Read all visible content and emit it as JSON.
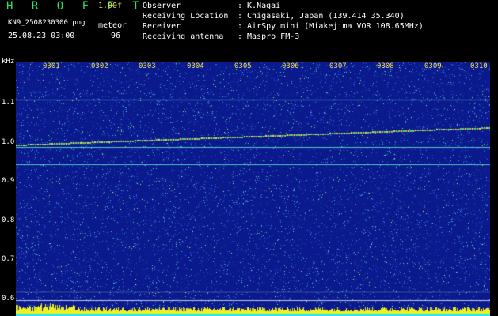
{
  "header": {
    "app_title": "H R O F F T",
    "version": "1.00f",
    "filename": "KN9_2508230300.png",
    "meteor_label": "meteor",
    "datetime": "25.08.23 03:00",
    "meteor_count": "96",
    "info": [
      {
        "label": "Observer",
        "value": ": K.Nagai"
      },
      {
        "label": "Receiving Location",
        "value": ": Chigasaki, Japan (139.414 35.340)"
      },
      {
        "label": "Receiver",
        "value": ": AirSpy mini (Miakejima VOR 108.65MHz)"
      },
      {
        "label": "Receiving antenna",
        "value": ": Maspro FM-3"
      }
    ]
  },
  "spectrogram": {
    "y_unit": "kHz",
    "y_ticks": [
      "1.1",
      "1.0",
      "0.9",
      "0.8",
      "0.7",
      "0.6"
    ],
    "x_ticks": [
      "0301",
      "0302",
      "0303",
      "0304",
      "0305",
      "0306",
      "0307",
      "0308",
      "0309",
      "0310"
    ]
  },
  "colors": {
    "background": "#0a1a8c",
    "label_green": "#2ee06a",
    "label_yellow": "#f0e040",
    "carrier": "#ff5555"
  }
}
